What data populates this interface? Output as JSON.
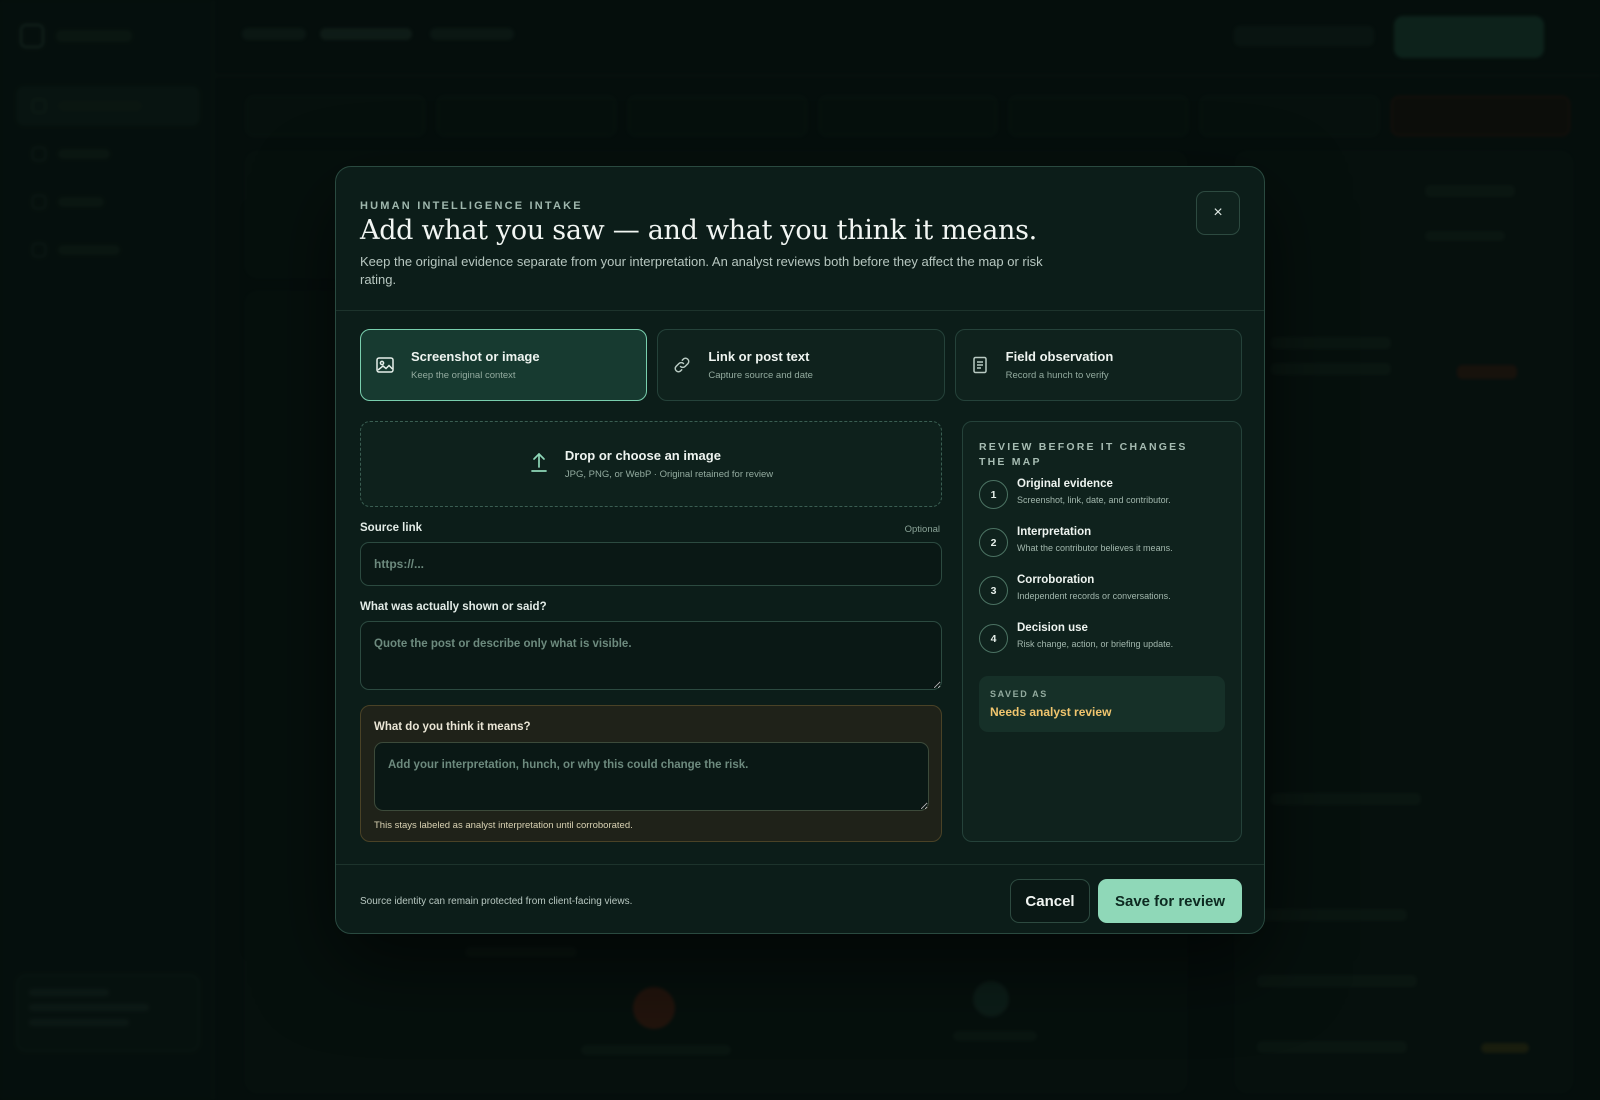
{
  "modal": {
    "eyebrow": "HUMAN INTELLIGENCE INTAKE",
    "title": "Add what you saw — and what you think it means.",
    "subtitle": "Keep the original evidence separate from your interpretation. An analyst reviews both before they affect the map or risk rating.",
    "close_glyph": "×"
  },
  "source_types": [
    {
      "label": "Screenshot or image",
      "hint": "Keep the original context",
      "icon": "image-icon",
      "selected": true
    },
    {
      "label": "Link or post text",
      "hint": "Capture source and date",
      "icon": "link-icon",
      "selected": false
    },
    {
      "label": "Field observation",
      "hint": "Record a hunch to verify",
      "icon": "note-icon",
      "selected": false
    }
  ],
  "dropzone": {
    "title": "Drop or choose an image",
    "hint": "JPG, PNG, or WebP · Original retained for review",
    "icon": "upload-icon"
  },
  "source_link": {
    "label": "Source link",
    "optional": "Optional",
    "placeholder": "https://...",
    "value": ""
  },
  "observation": {
    "label": "What was actually shown or said?",
    "placeholder": "Quote the post or describe only what is visible.",
    "value": ""
  },
  "interpretation": {
    "label": "What do you think it means?",
    "placeholder": "Add your interpretation, hunch, or why this could change the risk.",
    "value": "",
    "note": "This stays labeled as analyst interpretation until corroborated."
  },
  "review": {
    "title": "REVIEW BEFORE IT CHANGES THE MAP",
    "steps": [
      {
        "num": "1",
        "title": "Original evidence",
        "desc": "Screenshot, link, date, and contributor."
      },
      {
        "num": "2",
        "title": "Interpretation",
        "desc": "What the contributor believes it means."
      },
      {
        "num": "3",
        "title": "Corroboration",
        "desc": "Independent records or conversations."
      },
      {
        "num": "4",
        "title": "Decision use",
        "desc": "Risk change, action, or briefing update."
      }
    ],
    "saved_as_label": "SAVED AS",
    "saved_as_value": "Needs analyst review"
  },
  "footer": {
    "note": "Source identity can remain protected from client-facing views.",
    "cancel_label": "Cancel",
    "save_label": "Save for review"
  },
  "colors": {
    "accent": "#8fd8b8",
    "selected_border": "#79cfae",
    "pending_status": "#f0c56e"
  }
}
